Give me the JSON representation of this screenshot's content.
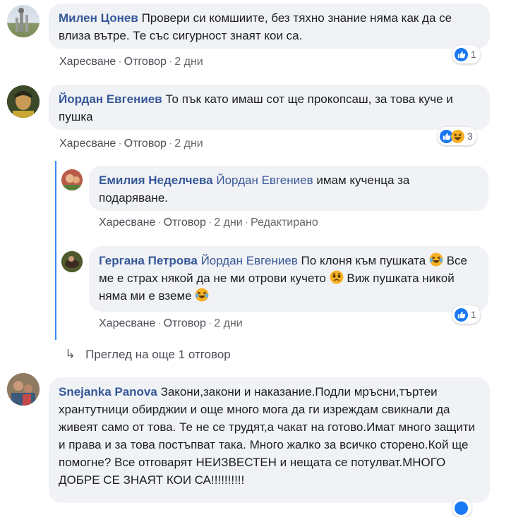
{
  "comments": [
    {
      "author": "Милен Цонев",
      "text": "Провери си комшиите, без тяхно знание няма как да се влиза вътре. Те със сигурност знаят кои са.",
      "actions": {
        "like": "Харесване",
        "reply": "Отговор",
        "time": "2 дни"
      },
      "reactions": {
        "count": "1",
        "types": [
          "like"
        ]
      }
    },
    {
      "author": "Йордан Евгениев",
      "text": "То пък като имаш сот ще прокопсаш, за това куче и пушка",
      "actions": {
        "like": "Харесване",
        "reply": "Отговор",
        "time": "2 дни"
      },
      "reactions": {
        "count": "3",
        "types": [
          "like",
          "haha"
        ]
      },
      "replies": [
        {
          "author": "Емилия Неделчева",
          "mention": "Йордан Евгениев",
          "text": "имам кученца за подаряване.",
          "actions": {
            "like": "Харесване",
            "reply": "Отговор",
            "time": "2 дни",
            "edited": "Редактирано"
          }
        },
        {
          "author": "Гергана Петрова",
          "mention": "Йордан Евгениев",
          "text_1": "По клоня към пушката",
          "text_2": "Все ме е страх някой да не ми отрови кучето",
          "text_3": "Виж пушката никой няма ми е вземе",
          "emoji": [
            "laughing-crying-emoji",
            "crying-emoji",
            "laughing-crying-emoji"
          ],
          "actions": {
            "like": "Харесване",
            "reply": "Отговор",
            "time": "2 дни"
          },
          "reactions": {
            "count": "1",
            "types": [
              "like"
            ]
          }
        }
      ],
      "more_replies": "Преглед на още 1 отговор"
    },
    {
      "author": "Snejanka Panova",
      "text": "Закони,закони и наказание.Подли мръсни,търтеи хрантутници обирджии и още много мога да ги изреждам свикнали да живеят само от това. Те не се трудят,а чакат на готово.Имат много защити и права и за това постъпват така. Много жалко за всичко сторено.Кой ще помогне? Все отговарят НЕИЗВЕСТЕН и нещата се потулват.МНОГО ДОБРЕ СЕ ЗНАЯТ КОИ СА!!!!!!!!!!"
    }
  ],
  "colors": {
    "link": "#365899",
    "bubble": "#f0f2f5",
    "like_blue": "#1877f2",
    "haha_yellow": "#f7b125"
  }
}
